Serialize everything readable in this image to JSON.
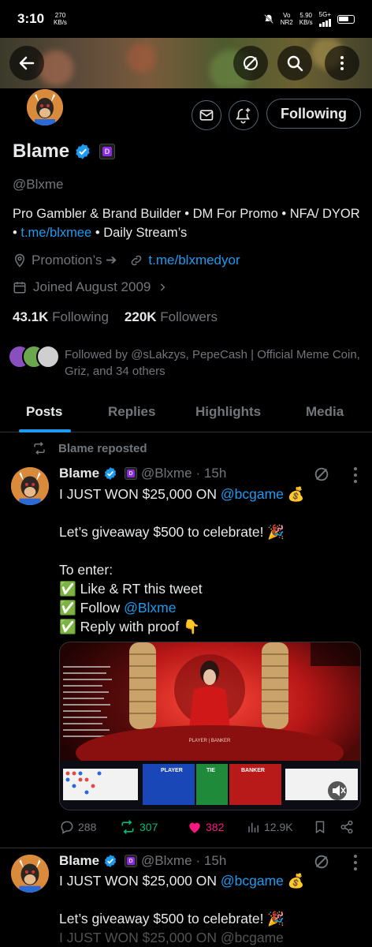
{
  "status_bar": {
    "time": "3:10",
    "net_speed_value": "270",
    "net_speed_unit": "KB/s",
    "vo_label": "Vo",
    "nr_label": "NR2",
    "speed2_value": "5.90",
    "speed2_unit": "KB/s",
    "network": "5G+"
  },
  "profile": {
    "name": "Blame",
    "handle": "@Blxme",
    "following_button": "Following",
    "bio_text_1": "Pro Gambler & Brand Builder • DM For Promo • NFA/ DYOR • ",
    "bio_link": "t.me/blxmee",
    "bio_text_2": " • Daily Stream’s",
    "location": "Promotion’s ➔",
    "website": "t.me/blxmedyor",
    "joined": "Joined August 2009",
    "following_count": "43.1K",
    "following_label": "Following",
    "followers_count": "220K",
    "followers_label": "Followers",
    "followed_by": "Followed by @sLakzys, PepeCash | Official Meme Coin, Griz, and 34 others"
  },
  "tabs": [
    {
      "label": "Posts",
      "active": true
    },
    {
      "label": "Replies",
      "active": false
    },
    {
      "label": "Highlights",
      "active": false
    },
    {
      "label": "Media",
      "active": false
    }
  ],
  "posts": [
    {
      "repost_label": "Blame reposted",
      "name": "Blame",
      "handle": "@Blxme",
      "time": "· 15h",
      "line1_pre": "I JUST WON $25,000 ON ",
      "line1_link": "@bcgame",
      "line1_emoji": "💰",
      "line2": "Let’s giveaway $500 to celebrate! 🎉",
      "line3": "To enter:",
      "line4": "✅ Like & RT this tweet",
      "line5_pre": "✅ Follow ",
      "line5_link": "@Blxme",
      "line6": "✅ Reply with proof 👇",
      "media_player_label": "PLAYER",
      "media_tie_label": "TIE",
      "media_banker_label": "BANKER",
      "media_table_label": "PLAYER | BANKER",
      "replies": "288",
      "reposts": "307",
      "likes": "382",
      "views": "12.9K"
    },
    {
      "name": "Blame",
      "handle": "@Blxme",
      "time": "· 15h",
      "line1_pre": "I JUST WON $25,000 ON ",
      "line1_link": "@bcgame",
      "line1_emoji": "💰",
      "line2": "Let’s giveaway $500 to celebrate! 🎉",
      "line3": "I JUST WON $25,000 ON @bcgame"
    }
  ],
  "colors": {
    "accent": "#1d9bf0",
    "repost_green": "#00ba7c",
    "like_pink": "#f91880",
    "muted": "#71767b"
  }
}
